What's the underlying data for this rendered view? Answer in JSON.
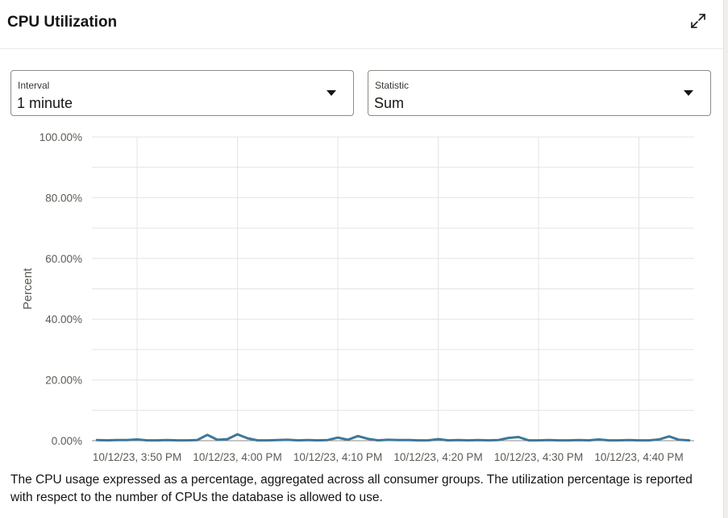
{
  "header": {
    "title": "CPU Utilization",
    "expand_icon": "expand-icon"
  },
  "controls": {
    "interval": {
      "label": "Interval",
      "value": "1 minute"
    },
    "statistic": {
      "label": "Statistic",
      "value": "Sum"
    }
  },
  "description": "The CPU usage expressed as a percentage, aggregated across all consumer groups. The utilization percentage is reported with respect to the number of CPUs the database is allowed to use.",
  "colors": {
    "series": "#3f7796",
    "grid": "#e6e4e1",
    "axis": "#8f8a85",
    "text": "#161513",
    "tick_text": "#5e5a55"
  },
  "chart_data": {
    "type": "line",
    "ylabel": "Percent",
    "xlabel": "",
    "ylim": [
      0,
      100
    ],
    "yticks": [
      "100.00%",
      "80.00%",
      "60.00%",
      "40.00%",
      "20.00%",
      "0.00%"
    ],
    "ytick_values": [
      100,
      80,
      60,
      40,
      20,
      0
    ],
    "xticks": [
      "10/12/23, 3:50 PM",
      "10/12/23, 4:00 PM",
      "10/12/23, 4:10 PM",
      "10/12/23, 4:20 PM",
      "10/12/23, 4:30 PM",
      "10/12/23, 4:40 PM"
    ],
    "xtick_minutes": [
      0,
      10,
      20,
      30,
      40,
      50
    ],
    "x_range_minutes": [
      -4.5,
      55.5
    ],
    "grid": true,
    "series": [
      {
        "x": [
          -4,
          -3,
          -2,
          -1,
          0,
          1,
          2,
          3,
          4,
          5,
          6,
          7,
          8,
          9,
          10,
          11,
          12,
          13,
          14,
          15,
          16,
          17,
          18,
          19,
          20,
          21,
          22,
          23,
          24,
          25,
          26,
          27,
          28,
          29,
          30,
          31,
          32,
          33,
          34,
          35,
          36,
          37,
          38,
          39,
          40,
          41,
          42,
          43,
          44,
          45,
          46,
          47,
          48,
          49,
          50,
          51,
          52,
          53,
          54,
          55
        ],
        "values": [
          0.2,
          0.1,
          0.2,
          0.2,
          0.4,
          0.1,
          0.1,
          0.2,
          0.1,
          0.1,
          0.2,
          1.9,
          0.3,
          0.5,
          2.1,
          0.8,
          0.1,
          0.1,
          0.2,
          0.3,
          0.1,
          0.2,
          0.1,
          0.2,
          1.0,
          0.3,
          1.5,
          0.6,
          0.1,
          0.3,
          0.2,
          0.2,
          0.1,
          0.1,
          0.5,
          0.1,
          0.2,
          0.1,
          0.2,
          0.1,
          0.2,
          0.9,
          1.2,
          0.1,
          0.1,
          0.2,
          0.1,
          0.1,
          0.2,
          0.1,
          0.4,
          0.1,
          0.1,
          0.2,
          0.1,
          0.1,
          0.4,
          1.4,
          0.3,
          0.1
        ]
      }
    ]
  }
}
